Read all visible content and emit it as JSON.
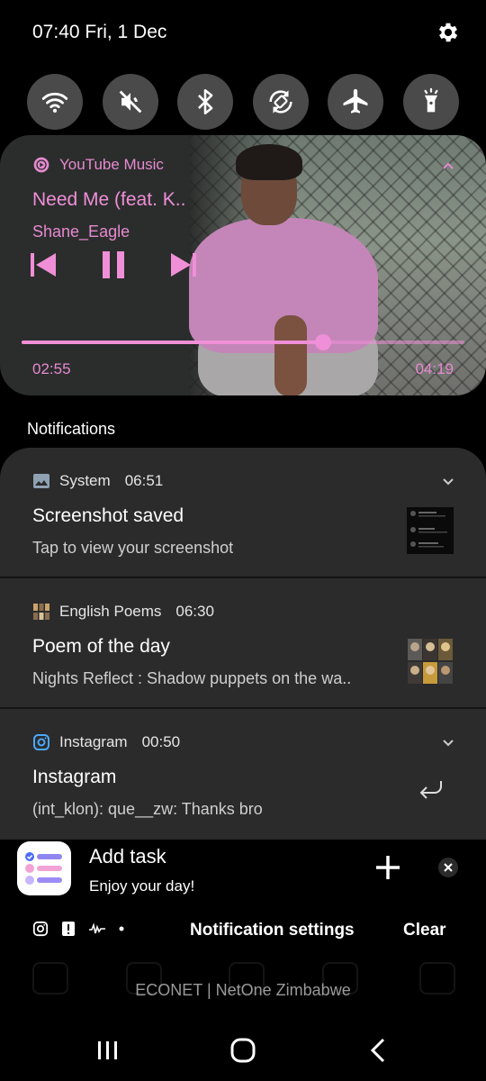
{
  "status": {
    "datetime": "07:40 Fri, 1 Dec"
  },
  "toggles": [
    {
      "name": "wifi-icon"
    },
    {
      "name": "mute-icon"
    },
    {
      "name": "bluetooth-icon"
    },
    {
      "name": "auto-rotate-icon"
    },
    {
      "name": "airplane-icon"
    },
    {
      "name": "flashlight-icon"
    }
  ],
  "media": {
    "app_name": "YouTube Music",
    "track": "Need Me (feat. K..",
    "artist": "Shane_Eagle",
    "elapsed": "02:55",
    "total": "04:19",
    "progress": 0.68,
    "accent": "#ef8fd7"
  },
  "notifications_header": "Notifications",
  "notifications": [
    {
      "app": "System",
      "time": "06:51",
      "title": "Screenshot saved",
      "body": "Tap to view your screenshot"
    },
    {
      "app": "English Poems",
      "time": "06:30",
      "title": "Poem of the day",
      "body": "Nights Reflect : Shadow puppets on the wa.."
    },
    {
      "app": "Instagram",
      "time": "00:50",
      "title": "Instagram",
      "body": "(int_klon): que__zw: Thanks bro"
    }
  ],
  "task": {
    "title": "Add task",
    "subtitle": "Enjoy your day!"
  },
  "footer": {
    "settings_label": "Notification settings",
    "clear_label": "Clear"
  },
  "carrier": "ECONET | NetOne Zimbabwe"
}
